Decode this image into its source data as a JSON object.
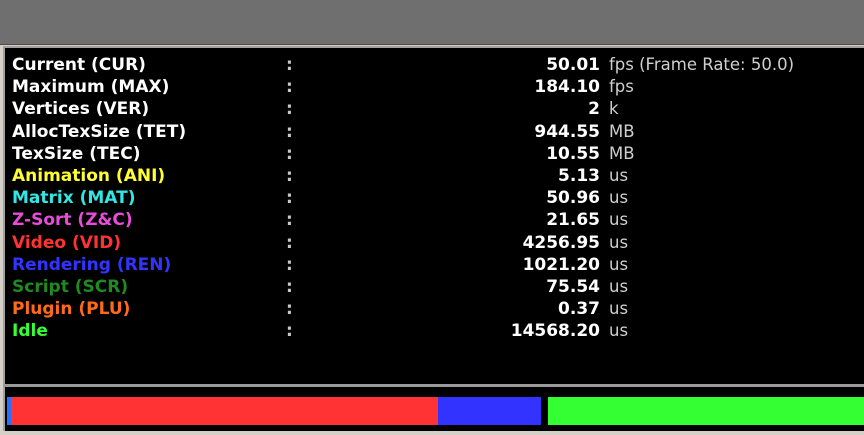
{
  "stats": [
    {
      "name": "Current (CUR)",
      "colon": ":",
      "value": "50.01",
      "unit": "fps (Frame Rate: 50.0)",
      "color": "#ffffff"
    },
    {
      "name": "Maximum (MAX)",
      "colon": ":",
      "value": "184.10",
      "unit": "fps",
      "color": "#ffffff"
    },
    {
      "name": "Vertices (VER)",
      "colon": ":",
      "value": "2",
      "unit": "k",
      "color": "#ffffff"
    },
    {
      "name": "AllocTexSize (TET)",
      "colon": ":",
      "value": "944.55",
      "unit": "MB",
      "color": "#ffffff"
    },
    {
      "name": "TexSize (TEC)",
      "colon": ":",
      "value": "10.55",
      "unit": "MB",
      "color": "#ffffff"
    },
    {
      "name": "Animation (ANI)",
      "colon": ":",
      "value": "5.13",
      "unit": "us",
      "color": "#ffff33"
    },
    {
      "name": "Matrix (MAT)",
      "colon": ":",
      "value": "50.96",
      "unit": "us",
      "color": "#33e6e6"
    },
    {
      "name": "Z-Sort (Z&C)",
      "colon": ":",
      "value": "21.65",
      "unit": "us",
      "color": "#e64dd9"
    },
    {
      "name": "Video (VID)",
      "colon": ":",
      "value": "4256.95",
      "unit": "us",
      "color": "#ff3333"
    },
    {
      "name": "Rendering (REN)",
      "colon": ":",
      "value": "1021.20",
      "unit": "us",
      "color": "#3333ff"
    },
    {
      "name": "Script (SCR)",
      "colon": ":",
      "value": "75.54",
      "unit": "us",
      "color": "#1f8a1f"
    },
    {
      "name": "Plugin (PLU)",
      "colon": ":",
      "value": "0.37",
      "unit": "us",
      "color": "#ff6a1a"
    },
    {
      "name": "Idle",
      "colon": ":",
      "value": "14568.20",
      "unit": "us",
      "color": "#33ff33"
    }
  ],
  "timing_bar": {
    "segments": [
      {
        "label": "Video (VID)",
        "fraction": 0.503,
        "color": "#ff3333"
      },
      {
        "label": "Rendering (REN)",
        "fraction": 0.12,
        "color": "#3333ff"
      },
      {
        "label": "Script (SCR)",
        "fraction": 0.008,
        "color": "#000000"
      },
      {
        "label": "Idle",
        "fraction": 0.369,
        "color": "#33ff33"
      }
    ],
    "cursor_color": "#2a6fff"
  },
  "colors": {
    "titlebar": "#6f6f6f",
    "panel_bg": "#000000",
    "chrome": "#d4d0c8"
  }
}
